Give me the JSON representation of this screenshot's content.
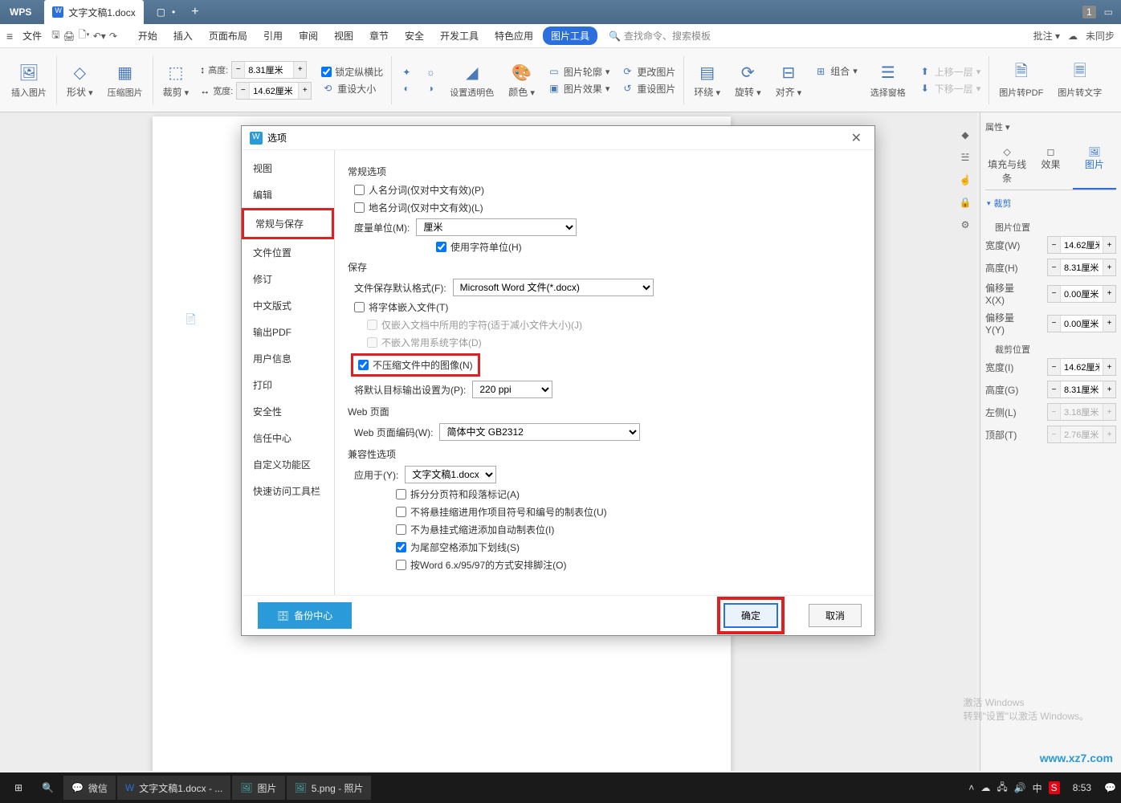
{
  "titlebar": {
    "app": "WPS",
    "tab_name": "文字文稿1.docx",
    "counter": "1"
  },
  "menubar": {
    "file": "文件",
    "items": [
      "开始",
      "插入",
      "页面布局",
      "引用",
      "审阅",
      "视图",
      "章节",
      "安全",
      "开发工具",
      "特色应用",
      "图片工具"
    ],
    "search_placeholder": "查找命令、搜索模板",
    "annotate": "批注 ▾",
    "sync": "未同步"
  },
  "ribbon": {
    "insert_pic": "插入图片",
    "shape": "形状",
    "compress": "压缩图片",
    "crop": "裁剪",
    "height_lbl": "高度:",
    "height_val": "8.31厘米",
    "width_lbl": "宽度:",
    "width_val": "14.62厘米",
    "lock_ratio": "锁定纵横比",
    "reset_size": "重设大小",
    "transparency": "设置透明色",
    "color": "颜色",
    "outline": "图片轮廓",
    "effect": "图片效果",
    "change": "更改图片",
    "reset": "重设图片",
    "wrap": "环绕",
    "rotate": "旋转",
    "align": "对齐",
    "group": "组合",
    "select_pane": "选择窗格",
    "move_up": "上移一层",
    "move_down": "下移一层",
    "to_pdf": "图片转PDF",
    "to_text": "图片转文字"
  },
  "sidepanel": {
    "props": "属性 ▾",
    "tabs": [
      "填充与线条",
      "效果",
      "图片"
    ],
    "crop": "裁剪",
    "pic_pos": "图片位置",
    "width_l": "宽度(W)",
    "width_v": "14.62厘米",
    "height_l": "高度(H)",
    "height_v": "8.31厘米",
    "offx_l": "偏移量 X(X)",
    "offx_v": "0.00厘米",
    "offy_l": "偏移量 Y(Y)",
    "offy_v": "0.00厘米",
    "crop_pos": "裁剪位置",
    "cw_l": "宽度(I)",
    "cw_v": "14.62厘米",
    "ch_l": "高度(G)",
    "ch_v": "8.31厘米",
    "left_l": "左侧(L)",
    "left_v": "3.18厘米",
    "top_l": "顶部(T)",
    "top_v": "2.76厘米"
  },
  "dialog": {
    "title": "选项",
    "side": [
      "视图",
      "编辑",
      "常规与保存",
      "文件位置",
      "修订",
      "中文版式",
      "输出PDF",
      "用户信息",
      "打印",
      "安全性",
      "信任中心",
      "自定义功能区",
      "快速访问工具栏"
    ],
    "sect_general": "常规选项",
    "chk_name_seg": "人名分词(仅对中文有效)(P)",
    "chk_place_seg": "地名分词(仅对中文有效)(L)",
    "unit_lbl": "度量单位(M):",
    "unit_val": "厘米",
    "chk_char_unit": "使用字符单位(H)",
    "sect_save": "保存",
    "def_fmt_lbl": "文件保存默认格式(F):",
    "def_fmt_val": "Microsoft Word 文件(*.docx)",
    "chk_embed": "将字体嵌入文件(T)",
    "chk_embed_used": "仅嵌入文档中所用的字符(适于减小文件大小)(J)",
    "chk_no_sys": "不嵌入常用系统字体(D)",
    "chk_no_compress": "不压缩文件中的图像(N)",
    "ppi_lbl": "将默认目标输出设置为(P):",
    "ppi_val": "220 ppi",
    "sect_web": "Web 页面",
    "web_enc_lbl": "Web 页面编码(W):",
    "web_enc_val": "简体中文 GB2312",
    "sect_compat": "兼容性选项",
    "apply_lbl": "应用于(Y):",
    "apply_val": "文字文稿1.docx",
    "chk_split": "拆分分页符和段落标记(A)",
    "chk_hang": "不将悬挂缩进用作项目符号和编号的制表位(U)",
    "chk_autotab": "不为悬挂式缩进添加自动制表位(I)",
    "chk_trail": "为尾部空格添加下划线(S)",
    "chk_word6": "按Word 6.x/95/97的方式安排脚注(O)",
    "backup": "备份中心",
    "ok": "确定",
    "cancel": "取消"
  },
  "watermark": {
    "title": "激活 Windows",
    "sub": "转到\"设置\"以激活 Windows。"
  },
  "taskbar": {
    "wechat": "微信",
    "wps": "文字文稿1.docx - ...",
    "pictures": "图片",
    "photo": "5.png - 照片",
    "clock": "8:53"
  },
  "logo": "www.xz7.com"
}
